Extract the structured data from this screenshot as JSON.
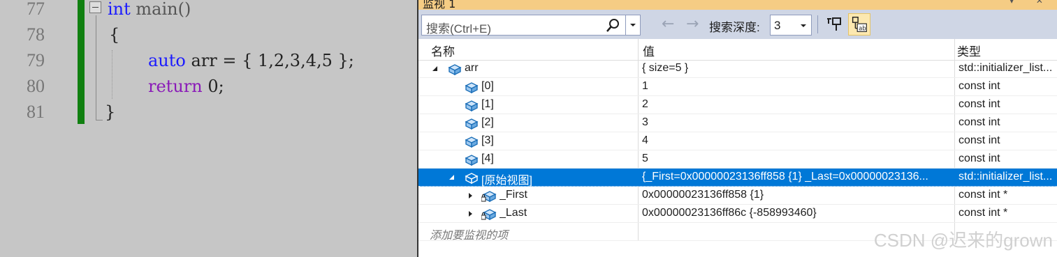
{
  "editor": {
    "lines": [
      {
        "num": "77"
      },
      {
        "num": "78",
        "text": "{"
      },
      {
        "num": "79",
        "kw": "auto",
        "text": " arr = { 1,2,3,4,5 };"
      },
      {
        "num": "80",
        "kw": "return",
        "text": " 0;"
      },
      {
        "num": "81",
        "text": "}"
      }
    ],
    "line77_kw": "int",
    "line77_text": " main()"
  },
  "watch": {
    "title": "监视 1",
    "search_placeholder": "搜索(Ctrl+E)",
    "depth_label": "搜索深度:",
    "depth_value": "3",
    "nav_back": "←",
    "nav_forward": "→",
    "columns": {
      "name": "名称",
      "value": "值",
      "type": "类型"
    },
    "rows": [
      {
        "name": "arr",
        "value": "{ size=5 }",
        "type": "std::initializer_list...",
        "expander": "open",
        "indent": 0
      },
      {
        "name": "[0]",
        "value": "1",
        "type": "const int",
        "expander": "none",
        "indent": 1
      },
      {
        "name": "[1]",
        "value": "2",
        "type": "const int",
        "expander": "none",
        "indent": 1
      },
      {
        "name": "[2]",
        "value": "3",
        "type": "const int",
        "expander": "none",
        "indent": 1
      },
      {
        "name": "[3]",
        "value": "4",
        "type": "const int",
        "expander": "none",
        "indent": 1
      },
      {
        "name": "[4]",
        "value": "5",
        "type": "const int",
        "expander": "none",
        "indent": 1
      },
      {
        "name": "[原始视图]",
        "value": "{_First=0x00000023136ff858 {1} _Last=0x00000023136...",
        "type": "std::initializer_list...",
        "expander": "open",
        "indent": 1,
        "selected": true
      },
      {
        "name": "_First",
        "value": "0x00000023136ff858 {1}",
        "type": "const int *",
        "expander": "closed",
        "indent": 2,
        "locked": true
      },
      {
        "name": "_Last",
        "value": "0x00000023136ff86c {-858993460}",
        "type": "const int *",
        "expander": "closed",
        "indent": 2,
        "locked": true
      }
    ],
    "add_watch_text": "添加要监视的项"
  },
  "watermark": "CSDN @迟来的grown",
  "colors": {
    "selection": "#0078d7",
    "title_bar": "#f5cc84",
    "toolbar": "#cfd6e5",
    "change_bar": "#108010"
  }
}
